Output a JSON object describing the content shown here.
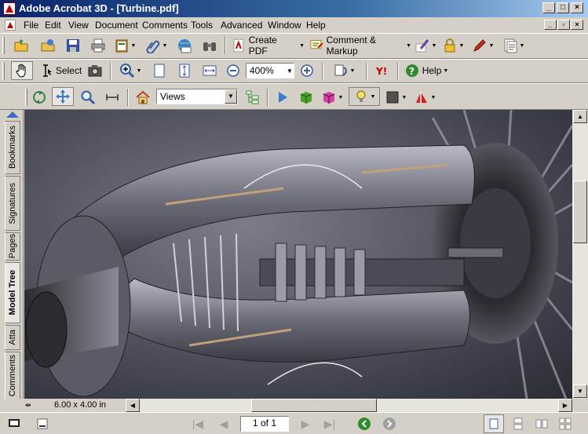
{
  "window": {
    "title": "Adobe Acrobat 3D - [Turbine.pdf]"
  },
  "menu": {
    "items": [
      "File",
      "Edit",
      "View",
      "Document",
      "Comments",
      "Tools",
      "Advanced",
      "Window",
      "Help"
    ]
  },
  "toolbar_main": {
    "create_pdf_label": "Create PDF",
    "comment_markup_label": "Comment & Markup"
  },
  "toolbar_nav": {
    "select_label": "Select",
    "zoom_value": "400%",
    "help_label": "Help"
  },
  "toolbar_3d": {
    "views_value": "Views"
  },
  "side_tabs": [
    "Bookmarks",
    "Signatures",
    "Pages",
    "Model Tree",
    "Atta",
    "Comments"
  ],
  "status": {
    "page_size": "6.00 x 4.00 in",
    "page_indicator": "1 of 1"
  },
  "colors": {
    "titlebar_start": "#0a246a",
    "titlebar_end": "#a6caf0",
    "chrome": "#d4d0c8",
    "pdf_red": "#c00000",
    "back_green": "#2e8b2e"
  }
}
